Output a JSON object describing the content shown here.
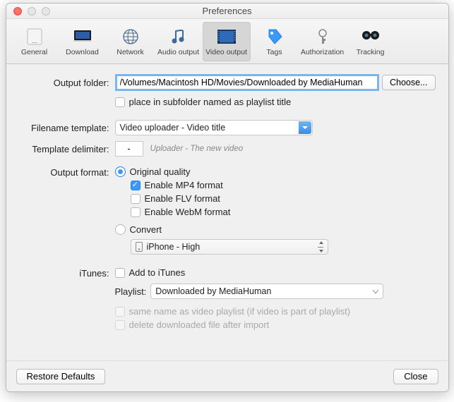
{
  "title": "Preferences",
  "toolbar": {
    "items": [
      {
        "label": "General",
        "icon": "general"
      },
      {
        "label": "Download",
        "icon": "download"
      },
      {
        "label": "Network",
        "icon": "network"
      },
      {
        "label": "Audio output",
        "icon": "audio"
      },
      {
        "label": "Video output",
        "icon": "video"
      },
      {
        "label": "Tags",
        "icon": "tags"
      },
      {
        "label": "Authorization",
        "icon": "auth"
      },
      {
        "label": "Tracking",
        "icon": "tracking"
      }
    ],
    "selected_index": 4
  },
  "form": {
    "output_folder_label": "Output folder:",
    "output_folder_value": "/Volumes/Macintosh HD/Movies/Downloaded by MediaHuman",
    "choose_label": "Choose...",
    "subfolder_label": "place in subfolder named as playlist title",
    "subfolder_checked": false,
    "filename_template_label": "Filename template:",
    "filename_template_value": "Video uploader - Video title",
    "template_delimiter_label": "Template delimiter:",
    "template_delimiter_value": "-",
    "template_hint": "Uploader - The new video",
    "output_format_label": "Output format:",
    "original_quality_label": "Original quality",
    "original_quality_checked": true,
    "enable_mp4_label": "Enable MP4 format",
    "enable_mp4_checked": true,
    "enable_flv_label": "Enable FLV format",
    "enable_flv_checked": false,
    "enable_webm_label": "Enable WebM format",
    "enable_webm_checked": false,
    "convert_label": "Convert",
    "convert_checked": false,
    "convert_preset": "iPhone - High",
    "itunes_label": "iTunes:",
    "add_to_itunes_label": "Add to iTunes",
    "add_to_itunes_checked": false,
    "playlist_label": "Playlist:",
    "playlist_value": "Downloaded by MediaHuman",
    "same_name_label": "same name as video playlist (if video is part of playlist)",
    "delete_after_label": "delete downloaded file after import"
  },
  "footer": {
    "restore_label": "Restore Defaults",
    "close_label": "Close"
  }
}
